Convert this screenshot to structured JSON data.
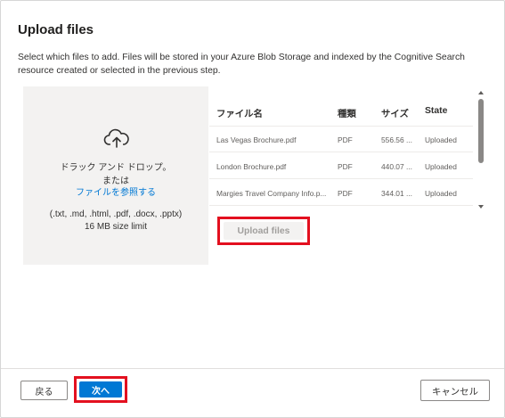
{
  "dialog": {
    "title": "Upload files",
    "description": "Select which files to add. Files will be stored in your Azure Blob Storage and indexed by the Cognitive Search resource created or selected in the previous step."
  },
  "dropzone": {
    "icon": "cloud-upload-icon",
    "line1": "ドラック アンド ドロップ。",
    "line2": "または",
    "browse_link": "ファイルを参照する",
    "file_types": "(.txt, .md, .html, .pdf, .docx, .pptx)",
    "size_limit": "16 MB size limit"
  },
  "file_table": {
    "headers": {
      "name": "ファイル名",
      "type": "種類",
      "size": "サイズ",
      "state": "State"
    },
    "rows": [
      {
        "name": "Las Vegas Brochure.pdf",
        "type": "PDF",
        "size": "556.56 ...",
        "state": "Uploaded"
      },
      {
        "name": "London Brochure.pdf",
        "type": "PDF",
        "size": "440.07 ...",
        "state": "Uploaded"
      },
      {
        "name": "Margies Travel Company Info.p...",
        "type": "PDF",
        "size": "344.01 ...",
        "state": "Uploaded"
      }
    ]
  },
  "upload_button": {
    "label": "Upload files"
  },
  "footer": {
    "back_label": "戻る",
    "next_label": "次へ",
    "cancel_label": "キャンセル"
  },
  "colors": {
    "accent": "#0078d4",
    "highlight": "#e3101f",
    "dropzone_bg": "#f3f2f1"
  }
}
